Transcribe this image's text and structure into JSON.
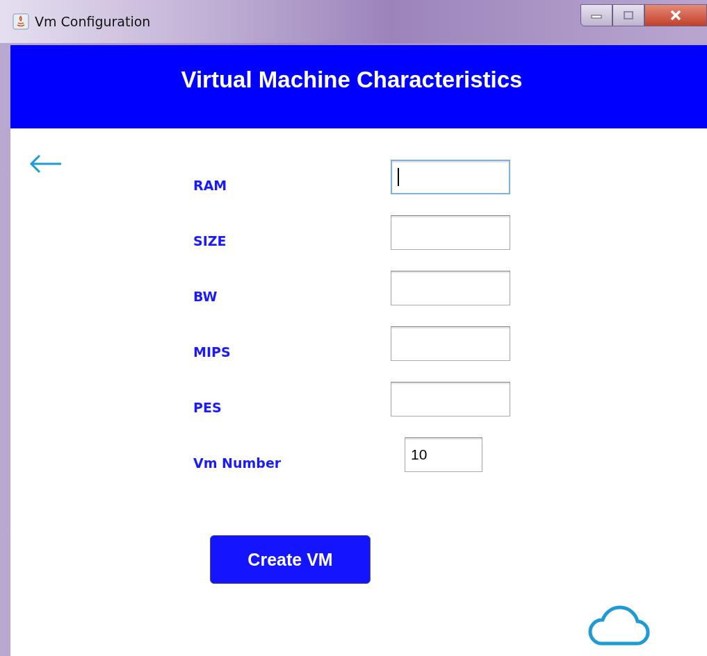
{
  "window": {
    "title": "Vm Configuration"
  },
  "header": {
    "title": "Virtual Machine Characteristics"
  },
  "fields": [
    {
      "label": "RAM",
      "focused": true,
      "kind": "wide"
    },
    {
      "label": "SIZE",
      "focused": false,
      "kind": "wide"
    },
    {
      "label": "BW",
      "focused": false,
      "kind": "wide"
    },
    {
      "label": "MIPS",
      "focused": false,
      "kind": "wide"
    },
    {
      "label": "PES",
      "focused": false,
      "kind": "wide"
    },
    {
      "label": "Vm Number",
      "value": "10",
      "focused": false,
      "kind": "narrow"
    }
  ],
  "button": {
    "label": "Create VM"
  }
}
